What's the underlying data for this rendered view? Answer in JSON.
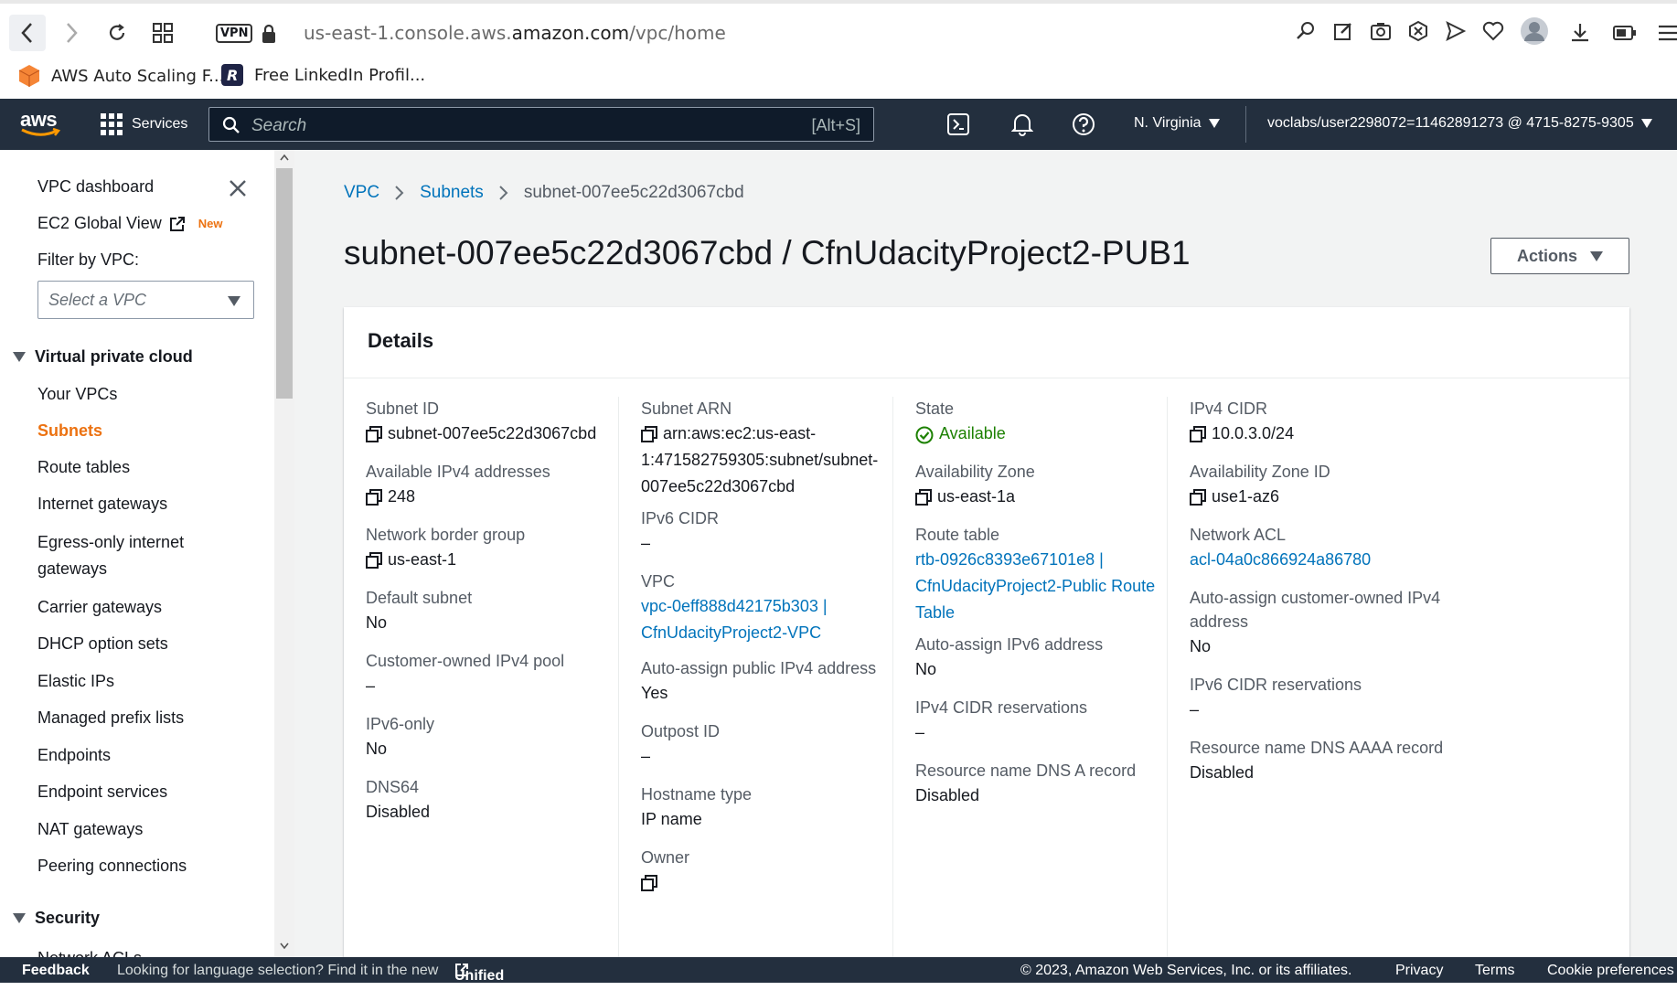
{
  "browser": {
    "url_gray": "us-east-1.console.aws.",
    "url_dark": "amazon.com",
    "url_path": "/vpc/home",
    "vpn": "VPN"
  },
  "bookmarks": [
    {
      "label": "AWS Auto Scaling F..."
    },
    {
      "label": "Free LinkedIn Profil..."
    }
  ],
  "topnav": {
    "logo": "aws",
    "services": "Services",
    "search_placeholder": "Search",
    "search_shortcut": "[Alt+S]",
    "region": "N. Virginia",
    "account": "voclabs/user2298072=11462891273 @ 4715-8275-9305"
  },
  "sidebar": {
    "dashboard": "VPC dashboard",
    "ec2_global": "EC2 Global View",
    "new_badge": "New",
    "filter_label": "Filter by VPC:",
    "filter_placeholder": "Select a VPC",
    "section_vpc": "Virtual private cloud",
    "items": [
      "Your VPCs",
      "Subnets",
      "Route tables",
      "Internet gateways",
      "Egress-only internet gateways",
      "Carrier gateways",
      "DHCP option sets",
      "Elastic IPs",
      "Managed prefix lists",
      "Endpoints",
      "Endpoint services",
      "NAT gateways",
      "Peering connections"
    ],
    "section_security": "Security",
    "partial_item": "Network ACLs"
  },
  "breadcrumb": {
    "vpc": "VPC",
    "subnets": "Subnets",
    "current": "subnet-007ee5c22d3067cbd"
  },
  "page": {
    "title": "subnet-007ee5c22d3067cbd / CfnUdacityProject2-PUB1",
    "actions": "Actions"
  },
  "details": {
    "heading": "Details",
    "col1": {
      "subnet_id_label": "Subnet ID",
      "subnet_id": "subnet-007ee5c22d3067cbd",
      "avail_ipv4_label": "Available IPv4 addresses",
      "avail_ipv4": "248",
      "border_group_label": "Network border group",
      "border_group": "us-east-1",
      "default_subnet_label": "Default subnet",
      "default_subnet": "No",
      "co_pool_label": "Customer-owned IPv4 pool",
      "co_pool": "–",
      "ipv6_only_label": "IPv6-only",
      "ipv6_only": "No",
      "dns64_label": "DNS64",
      "dns64": "Disabled"
    },
    "col2": {
      "arn_label": "Subnet ARN",
      "arn_1": "arn:aws:ec2:us-east-",
      "arn_2": "1:471582759305:subnet/subnet-",
      "arn_3": "007ee5c22d3067cbd",
      "ipv6_cidr_label": "IPv6 CIDR",
      "ipv6_cidr": "–",
      "vpc_label": "VPC",
      "vpc_1": "vpc-0eff888d42175b303 |",
      "vpc_2": "CfnUdacityProject2-VPC",
      "auto_public_label": "Auto-assign public IPv4 address",
      "auto_public": "Yes",
      "outpost_label": "Outpost ID",
      "outpost": "–",
      "hostname_label": "Hostname type",
      "hostname": "IP name",
      "owner_label": "Owner"
    },
    "col3": {
      "state_label": "State",
      "state": "Available",
      "az_label": "Availability Zone",
      "az": "us-east-1a",
      "rt_label": "Route table",
      "rt_1": "rtb-0926c8393e67101e8 |",
      "rt_2": "CfnUdacityProject2-Public Route",
      "rt_3": "Table",
      "auto_ipv6_label": "Auto-assign IPv6 address",
      "auto_ipv6": "No",
      "ipv4_res_label": "IPv4 CIDR reservations",
      "ipv4_res": "–",
      "dns_a_label": "Resource name DNS A record",
      "dns_a": "Disabled"
    },
    "col4": {
      "cidr_label": "IPv4 CIDR",
      "cidr": "10.0.3.0/24",
      "az_id_label": "Availability Zone ID",
      "az_id": "use1-az6",
      "nacl_label": "Network ACL",
      "nacl": "acl-04a0c866924a86780",
      "co_ipv4_label_1": "Auto-assign customer-owned IPv4",
      "co_ipv4_label_2": "address",
      "co_ipv4": "No",
      "ipv6_res_label": "IPv6 CIDR reservations",
      "ipv6_res": "–",
      "dns_aaaa_label": "Resource name DNS AAAA record",
      "dns_aaaa": "Disabled"
    }
  },
  "footer": {
    "feedback": "Feedback",
    "lang_text": "Looking for language selection? Find it in the new",
    "unified": "Unified Settings",
    "copyright": "© 2023, Amazon Web Services, Inc. or its affiliates.",
    "privacy": "Privacy",
    "terms": "Terms",
    "cookie": "Cookie preferences"
  }
}
